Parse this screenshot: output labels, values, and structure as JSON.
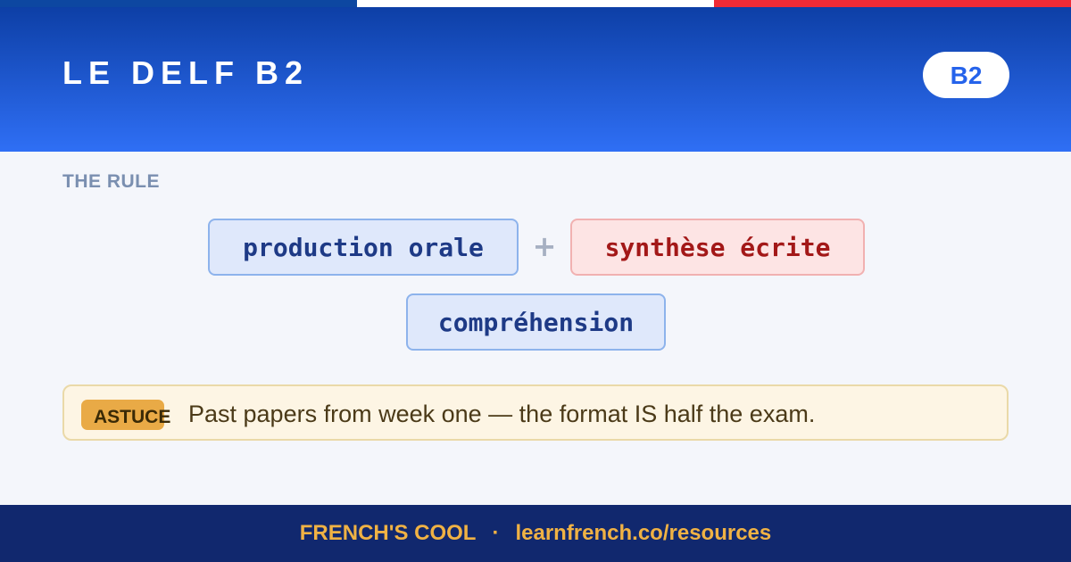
{
  "colors": {
    "flag_blue": "#0d47a1",
    "flag_white": "#ffffff",
    "flag_red": "#ef2b36",
    "header_top": "#0d3fa6",
    "header_bottom": "#2f6ff5",
    "accent_gold": "#f0b244",
    "footer_bg": "#11286e"
  },
  "header": {
    "title": "LE DELF B2",
    "level_badge": "B2"
  },
  "rule": {
    "section_label": "THE RULE",
    "chips": [
      {
        "text": "production orale",
        "style": "blue"
      },
      {
        "text": "synthèse écrite",
        "style": "red"
      },
      {
        "text": "compréhension",
        "style": "blue"
      }
    ],
    "joiner": "+"
  },
  "tip": {
    "badge": "ASTUCE",
    "text": "Past papers from week one — the format IS half the exam."
  },
  "footer": {
    "brand": "FRENCH'S COOL",
    "separator": "·",
    "url": "learnfrench.co/resources"
  }
}
